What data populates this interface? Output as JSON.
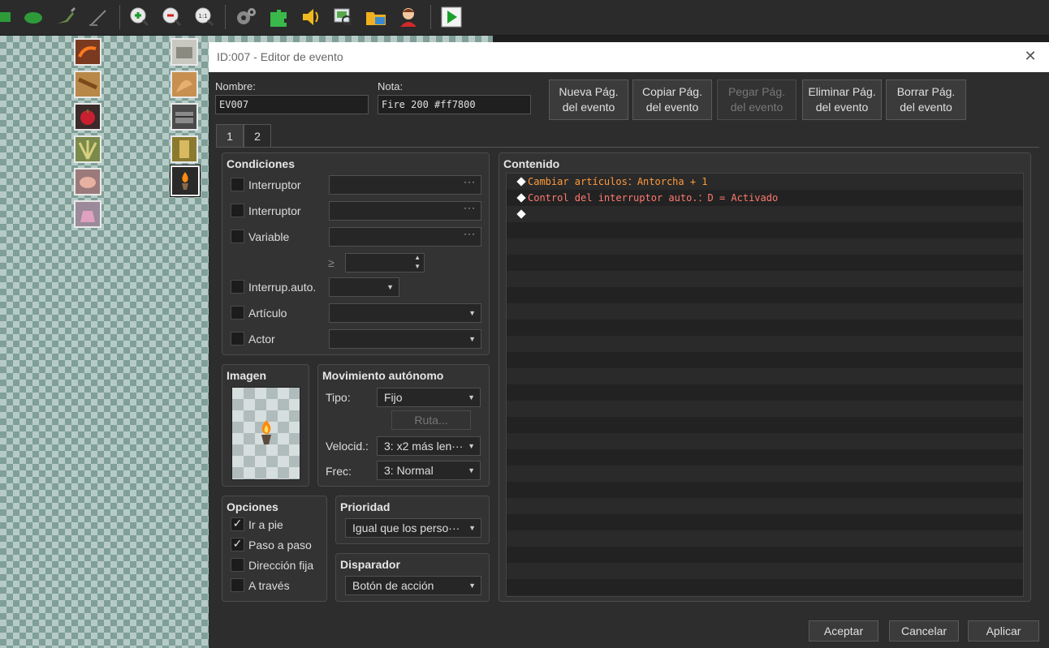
{
  "toolbar": {
    "icons": [
      "rect-tool-icon",
      "ellipse-tool-icon",
      "fill-tool-icon",
      "shadow-pen-icon",
      "zoom-in-icon",
      "zoom-out-icon",
      "zoom-actual-icon",
      "database-gear-icon",
      "plugin-manager-icon",
      "sound-test-icon",
      "event-searcher-icon",
      "resource-manager-icon",
      "character-generator-icon",
      "playtest-icon"
    ],
    "zoom_label": "1:1"
  },
  "dialog": {
    "title": "ID:007 - Editor de evento",
    "name_label": "Nombre:",
    "name_value": "EV007",
    "note_label": "Nota:",
    "note_value": "Fire 200 #ff7800",
    "page_buttons": [
      {
        "line1": "Nueva Pág.",
        "line2": "del evento",
        "enabled": true
      },
      {
        "line1": "Copiar Pág.",
        "line2": "del evento",
        "enabled": true
      },
      {
        "line1": "Pegar Pág.",
        "line2": "del evento",
        "enabled": false
      },
      {
        "line1": "Eliminar Pág.",
        "line2": "del evento",
        "enabled": true
      },
      {
        "line1": "Borrar Pág.",
        "line2": "del evento",
        "enabled": true
      }
    ],
    "tabs": [
      "1",
      "2"
    ],
    "conditions": {
      "title": "Condiciones",
      "rows": [
        "Interruptor",
        "Interruptor",
        "Variable",
        "Interrup.auto.",
        "Artículo",
        "Actor"
      ],
      "ge_symbol": "≥",
      "ellipsis": "···"
    },
    "image": {
      "title": "Imagen"
    },
    "movement": {
      "title": "Movimiento autónomo",
      "type_label": "Tipo:",
      "type_value": "Fijo",
      "route_label": "Ruta...",
      "speed_label": "Velocid.:",
      "speed_value": "3: x2 más len···",
      "freq_label": "Frec:",
      "freq_value": "3: Normal"
    },
    "options": {
      "title": "Opciones",
      "items": [
        {
          "label": "Ir a pie",
          "checked": "✓"
        },
        {
          "label": "Paso a paso",
          "checked": "✓"
        },
        {
          "label": "Dirección fija",
          "checked": ""
        },
        {
          "label": "A través",
          "checked": ""
        }
      ]
    },
    "priority": {
      "title": "Prioridad",
      "value": "Igual que los perso···"
    },
    "trigger": {
      "title": "Disparador",
      "value": "Botón de acción"
    },
    "content": {
      "title": "Contenido",
      "commands": [
        {
          "text": "Cambiar artículos：Antorcha + 1",
          "color": "#ff9a3c"
        },
        {
          "text": "Control del interruptor auto.：D = Activado",
          "color": "#ff7a70"
        },
        {
          "text": "",
          "color": "#ffffff"
        }
      ]
    },
    "footer": {
      "ok": "Aceptar",
      "cancel": "Cancelar",
      "apply": "Aplicar"
    }
  }
}
